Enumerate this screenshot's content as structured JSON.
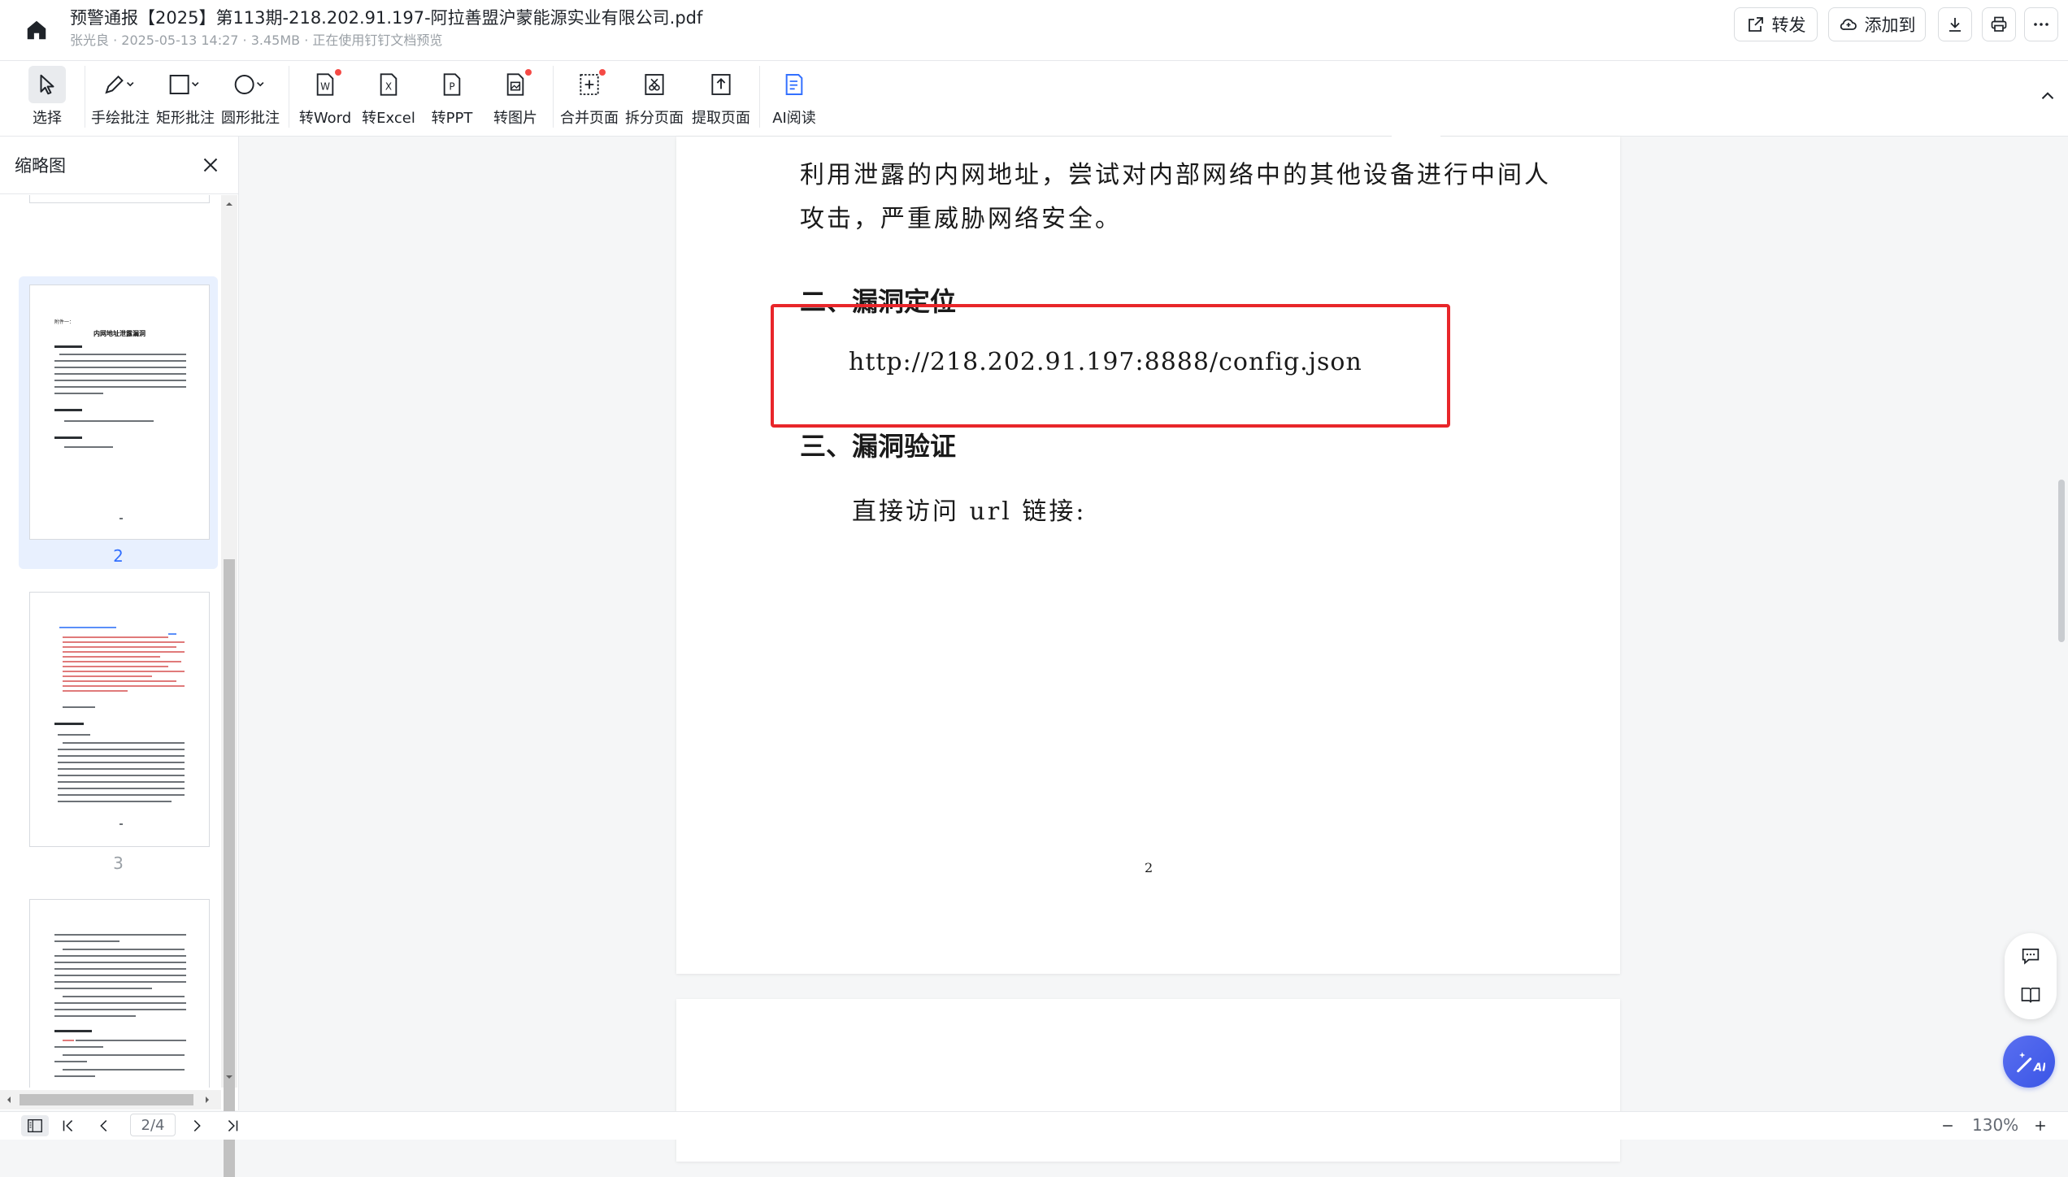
{
  "header": {
    "title": "预警通报【2025】第113期-218.202.91.197-阿拉善盟沪蒙能源实业有限公司.pdf",
    "subtitle": "张光良 · 2025-05-13 14:27 · 3.45MB · 正在使用钉钉文档预览",
    "forward_label": "转发",
    "add_to_label": "添加到"
  },
  "toolbar": {
    "items": [
      {
        "label": "选择",
        "icon": "cursor-icon"
      },
      {
        "label": "手绘批注",
        "icon": "pen-icon"
      },
      {
        "label": "矩形批注",
        "icon": "rectangle-icon"
      },
      {
        "label": "圆形批注",
        "icon": "circle-icon"
      },
      {
        "label": "转Word",
        "icon": "word-icon"
      },
      {
        "label": "转Excel",
        "icon": "excel-icon"
      },
      {
        "label": "转PPT",
        "icon": "ppt-icon"
      },
      {
        "label": "转图片",
        "icon": "image-icon"
      },
      {
        "label": "合并页面",
        "icon": "merge-icon"
      },
      {
        "label": "拆分页面",
        "icon": "split-icon"
      },
      {
        "label": "提取页面",
        "icon": "extract-icon"
      },
      {
        "label": "AI阅读",
        "icon": "ai-read-icon"
      }
    ]
  },
  "sidebar": {
    "title": "缩略图",
    "thumbnails": [
      {
        "number": "2",
        "selected": true
      },
      {
        "number": "3",
        "selected": false
      }
    ],
    "thumb_page2": {
      "heading": "附件一：",
      "title": "内网地址泄露漏洞"
    }
  },
  "document": {
    "line1": "利用泄露的内网地址，尝试对内部网络中的其他设备进行中间人",
    "line2": "攻击，严重威胁网络安全。",
    "section2_heading": "二、漏洞定位",
    "url": "http://218.202.91.197:8888/config.json",
    "section3_heading": "三、漏洞验证",
    "line3": "直接访问 url 链接:",
    "page_number": "2"
  },
  "bottom": {
    "page_indicator": "2/4",
    "zoom": "130%"
  },
  "colors": {
    "accent": "#3370ff",
    "highlight_box": "#e8262a",
    "ai_button": "#3a55e6"
  }
}
